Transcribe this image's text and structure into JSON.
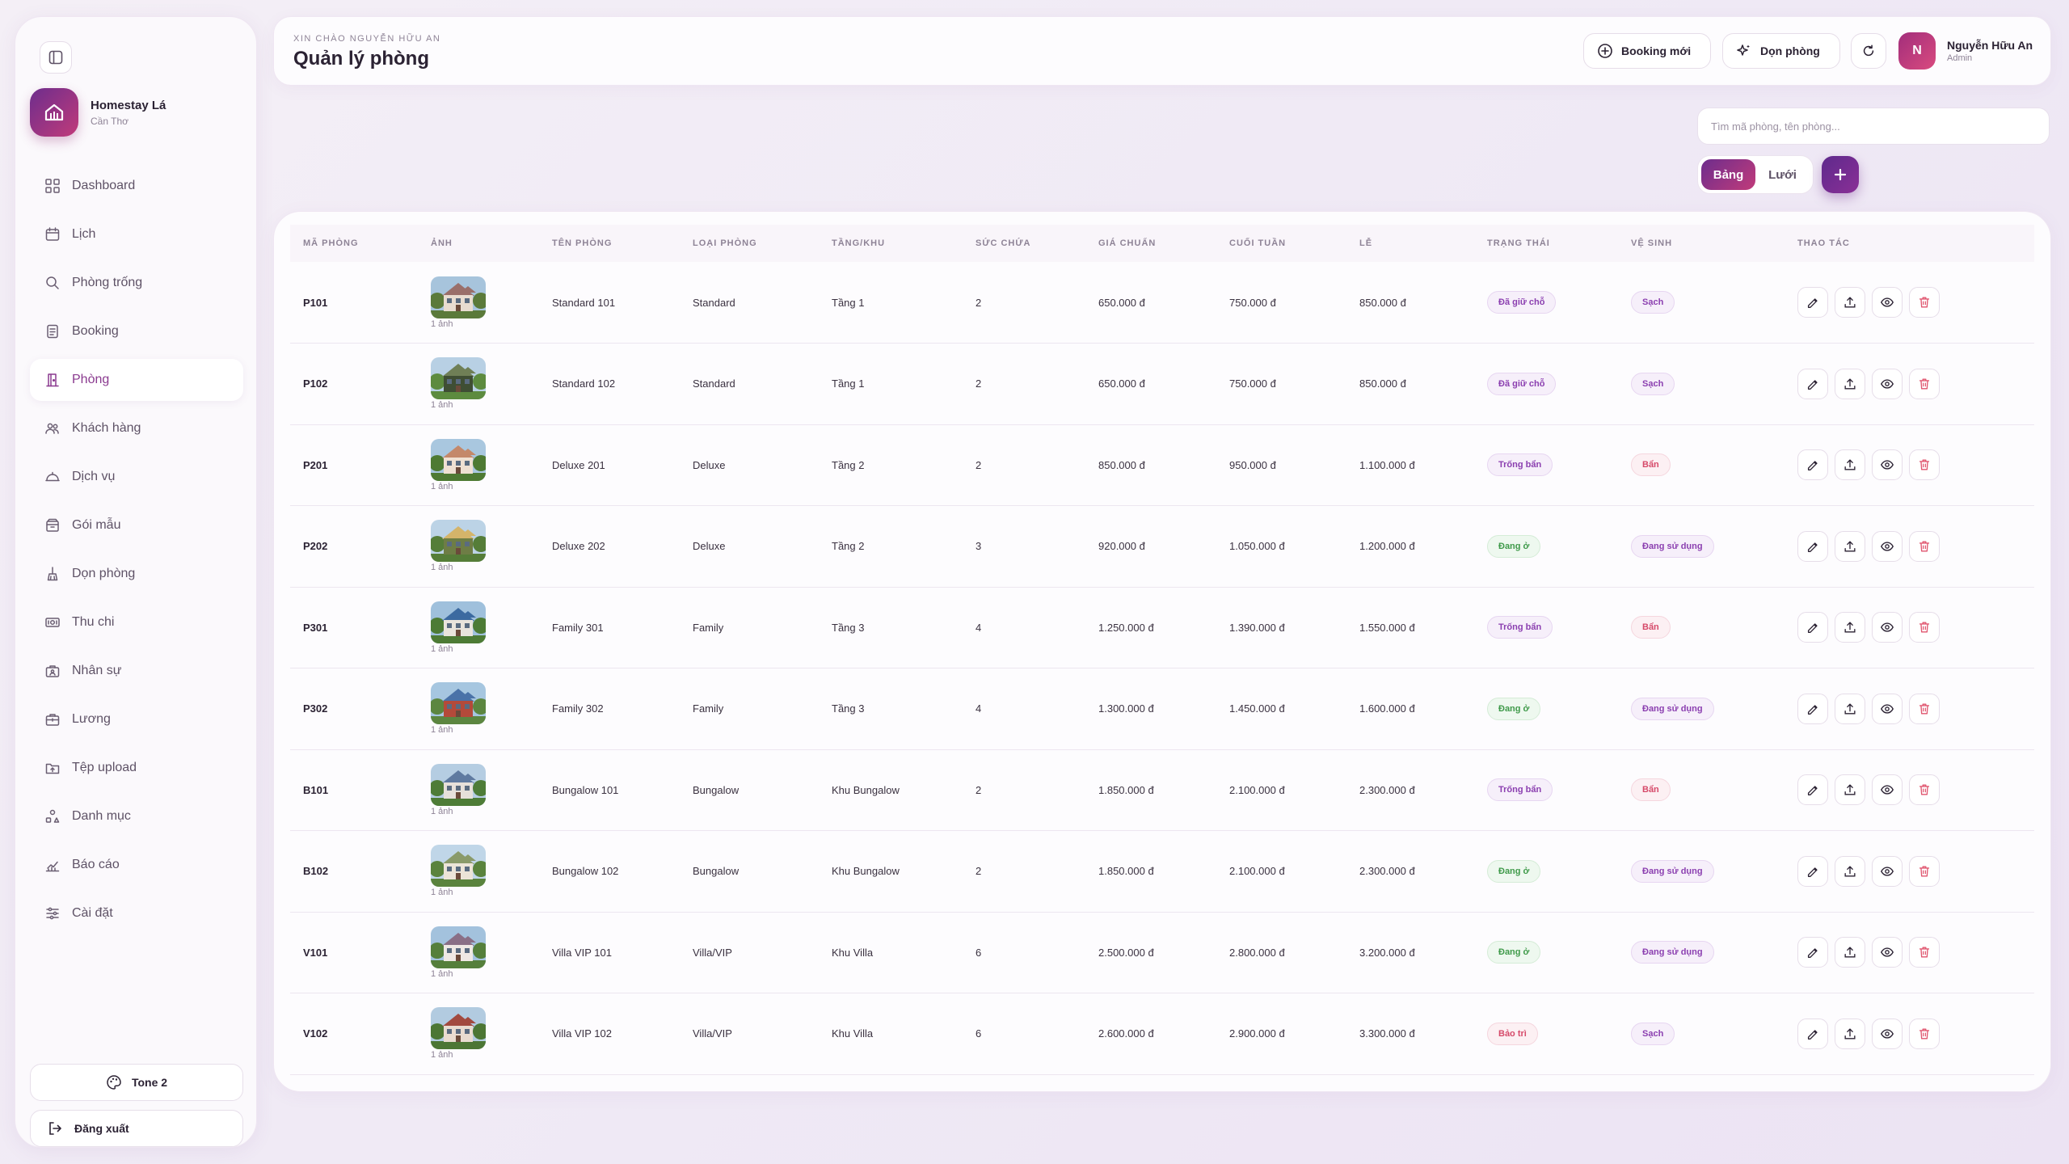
{
  "brand": {
    "name": "Homestay Lá",
    "city": "Cần Thơ"
  },
  "sidebar": {
    "items": [
      {
        "label": "Dashboard",
        "icon": "grid-icon"
      },
      {
        "label": "Lịch",
        "icon": "calendar-icon"
      },
      {
        "label": "Phòng trống",
        "icon": "search-icon"
      },
      {
        "label": "Booking",
        "icon": "booking-icon"
      },
      {
        "label": "Phòng",
        "icon": "door-icon",
        "active": true
      },
      {
        "label": "Khách hàng",
        "icon": "users-icon"
      },
      {
        "label": "Dịch vụ",
        "icon": "service-icon"
      },
      {
        "label": "Gói mẫu",
        "icon": "package-icon"
      },
      {
        "label": "Dọn phòng",
        "icon": "broom-icon"
      },
      {
        "label": "Thu chi",
        "icon": "money-icon"
      },
      {
        "label": "Nhân sự",
        "icon": "staff-icon"
      },
      {
        "label": "Lương",
        "icon": "salary-icon"
      },
      {
        "label": "Tệp upload",
        "icon": "folder-icon"
      },
      {
        "label": "Danh mục",
        "icon": "category-icon"
      },
      {
        "label": "Báo cáo",
        "icon": "report-icon"
      },
      {
        "label": "Cài đặt",
        "icon": "settings-icon"
      }
    ],
    "tone_label": "Tone 2",
    "logout_label": "Đăng xuất"
  },
  "header": {
    "greeting": "XIN CHÀO NGUYỄN HỮU AN",
    "title": "Quản lý phòng",
    "new_booking_label": "Booking mới",
    "clean_label": "Dọn phòng"
  },
  "user": {
    "initial": "N",
    "name": "Nguyễn Hữu An",
    "role": "Admin"
  },
  "search": {
    "placeholder": "Tìm mã phòng, tên phòng...",
    "value": ""
  },
  "view_toggle": {
    "table": "Bảng",
    "grid": "Lưới",
    "active": "table"
  },
  "table": {
    "headers": [
      "MÃ PHÒNG",
      "ẢNH",
      "TÊN PHÒNG",
      "LOẠI PHÒNG",
      "TẦNG/KHU",
      "SỨC CHỨA",
      "GIÁ CHUẨN",
      "CUỐI TUẦN",
      "LỄ",
      "TRẠNG THÁI",
      "VỆ SINH",
      "THAO TÁC"
    ],
    "rows": [
      {
        "code": "P101",
        "photos": "1 ảnh",
        "name": "Standard 101",
        "type": "Standard",
        "floor": "Tầng 1",
        "capacity": "2",
        "price": "650.000 đ",
        "weekend": "750.000 đ",
        "holiday": "850.000 đ",
        "status": "Đã giữ chỗ",
        "status_kind": "held",
        "clean": "Sạch",
        "clean_kind": "clean"
      },
      {
        "code": "P102",
        "photos": "1 ảnh",
        "name": "Standard 102",
        "type": "Standard",
        "floor": "Tầng 1",
        "capacity": "2",
        "price": "650.000 đ",
        "weekend": "750.000 đ",
        "holiday": "850.000 đ",
        "status": "Đã giữ chỗ",
        "status_kind": "held",
        "clean": "Sạch",
        "clean_kind": "clean"
      },
      {
        "code": "P201",
        "photos": "1 ảnh",
        "name": "Deluxe 201",
        "type": "Deluxe",
        "floor": "Tầng 2",
        "capacity": "2",
        "price": "850.000 đ",
        "weekend": "950.000 đ",
        "holiday": "1.100.000 đ",
        "status": "Trống bẩn",
        "status_kind": "empty",
        "clean": "Bẩn",
        "clean_kind": "dirty"
      },
      {
        "code": "P202",
        "photos": "1 ảnh",
        "name": "Deluxe 202",
        "type": "Deluxe",
        "floor": "Tầng 2",
        "capacity": "3",
        "price": "920.000 đ",
        "weekend": "1.050.000 đ",
        "holiday": "1.200.000 đ",
        "status": "Đang ở",
        "status_kind": "stay",
        "clean": "Đang sử dụng",
        "clean_kind": "using"
      },
      {
        "code": "P301",
        "photos": "1 ảnh",
        "name": "Family 301",
        "type": "Family",
        "floor": "Tầng 3",
        "capacity": "4",
        "price": "1.250.000 đ",
        "weekend": "1.390.000 đ",
        "holiday": "1.550.000 đ",
        "status": "Trống bẩn",
        "status_kind": "empty",
        "clean": "Bẩn",
        "clean_kind": "dirty"
      },
      {
        "code": "P302",
        "photos": "1 ảnh",
        "name": "Family 302",
        "type": "Family",
        "floor": "Tầng 3",
        "capacity": "4",
        "price": "1.300.000 đ",
        "weekend": "1.450.000 đ",
        "holiday": "1.600.000 đ",
        "status": "Đang ở",
        "status_kind": "stay",
        "clean": "Đang sử dụng",
        "clean_kind": "using"
      },
      {
        "code": "B101",
        "photos": "1 ảnh",
        "name": "Bungalow 101",
        "type": "Bungalow",
        "floor": "Khu Bungalow",
        "capacity": "2",
        "price": "1.850.000 đ",
        "weekend": "2.100.000 đ",
        "holiday": "2.300.000 đ",
        "status": "Trống bẩn",
        "status_kind": "empty",
        "clean": "Bẩn",
        "clean_kind": "dirty"
      },
      {
        "code": "B102",
        "photos": "1 ảnh",
        "name": "Bungalow 102",
        "type": "Bungalow",
        "floor": "Khu Bungalow",
        "capacity": "2",
        "price": "1.850.000 đ",
        "weekend": "2.100.000 đ",
        "holiday": "2.300.000 đ",
        "status": "Đang ở",
        "status_kind": "stay",
        "clean": "Đang sử dụng",
        "clean_kind": "using"
      },
      {
        "code": "V101",
        "photos": "1 ảnh",
        "name": "Villa VIP 101",
        "type": "Villa/VIP",
        "floor": "Khu Villa",
        "capacity": "6",
        "price": "2.500.000 đ",
        "weekend": "2.800.000 đ",
        "holiday": "3.200.000 đ",
        "status": "Đang ở",
        "status_kind": "stay",
        "clean": "Đang sử dụng",
        "clean_kind": "using"
      },
      {
        "code": "V102",
        "photos": "1 ảnh",
        "name": "Villa VIP 102",
        "type": "Villa/VIP",
        "floor": "Khu Villa",
        "capacity": "6",
        "price": "2.600.000 đ",
        "weekend": "2.900.000 đ",
        "holiday": "3.300.000 đ",
        "status": "Bảo trì",
        "status_kind": "maint",
        "clean": "Sạch",
        "clean_kind": "clean"
      }
    ]
  },
  "colors": {
    "accent": "#8a3a8f",
    "gradient_start": "#6d2d8d",
    "gradient_end": "#c13b7a",
    "danger": "#d64a6a",
    "success": "#3f9a4a"
  }
}
